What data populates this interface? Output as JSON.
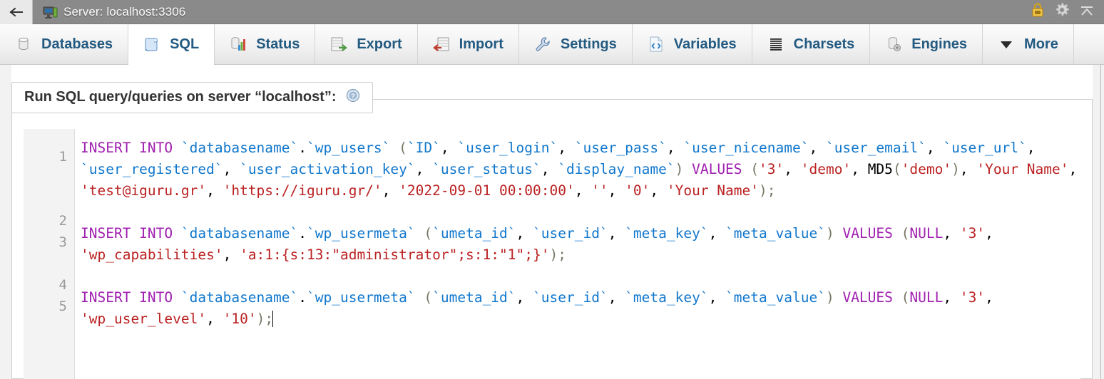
{
  "titlebar": {
    "back_icon": "back-arrow-icon",
    "server_icon": "server-monitor-icon",
    "title": "Server: localhost:3306",
    "right_icons": [
      {
        "name": "lock-icon",
        "label": "Lock"
      },
      {
        "name": "gear-icon",
        "label": "Settings"
      },
      {
        "name": "collapse-icon",
        "label": "Collapse"
      }
    ]
  },
  "tabs": [
    {
      "label": "Databases",
      "icon": "database-icon",
      "active": false
    },
    {
      "label": "SQL",
      "icon": "sql-scroll-icon",
      "active": true
    },
    {
      "label": "Status",
      "icon": "status-chart-icon",
      "active": false
    },
    {
      "label": "Export",
      "icon": "export-icon",
      "active": false
    },
    {
      "label": "Import",
      "icon": "import-icon",
      "active": false
    },
    {
      "label": "Settings",
      "icon": "wrench-icon",
      "active": false
    },
    {
      "label": "Variables",
      "icon": "code-file-icon",
      "active": false
    },
    {
      "label": "Charsets",
      "icon": "charsets-icon",
      "active": false
    },
    {
      "label": "Engines",
      "icon": "engines-icon",
      "active": false
    },
    {
      "label": "More",
      "icon": "chevron-down-icon",
      "active": false
    }
  ],
  "panel": {
    "legend": "Run SQL query/queries on server “localhost”:",
    "help_icon": "help-question-icon"
  },
  "editor": {
    "line_numbers": [
      "1",
      "2",
      "3",
      "4",
      "5"
    ],
    "statements": [
      {
        "line": 1,
        "tokens": [
          {
            "t": "INSERT INTO ",
            "c": "k"
          },
          {
            "t": "`databasename`",
            "c": "id"
          },
          {
            "t": ".",
            "c": "pl"
          },
          {
            "t": "`wp_users`",
            "c": "id"
          },
          {
            "t": " (",
            "c": "p"
          },
          {
            "t": "`ID`",
            "c": "id"
          },
          {
            "t": ", ",
            "c": "pl"
          },
          {
            "t": "`user_login`",
            "c": "id"
          },
          {
            "t": ", ",
            "c": "pl"
          },
          {
            "t": "`user_pass`",
            "c": "id"
          },
          {
            "t": ", ",
            "c": "pl"
          },
          {
            "t": "`user_nicename`",
            "c": "id"
          },
          {
            "t": ", ",
            "c": "pl"
          },
          {
            "t": "`user_email`",
            "c": "id"
          },
          {
            "t": ", ",
            "c": "pl"
          },
          {
            "t": "`user_url`",
            "c": "id"
          },
          {
            "t": ", ",
            "c": "pl"
          },
          {
            "t": "`user_registered`",
            "c": "id"
          },
          {
            "t": ", ",
            "c": "pl"
          },
          {
            "t": "`user_activation_key`",
            "c": "id"
          },
          {
            "t": ", ",
            "c": "pl"
          },
          {
            "t": "`user_status`",
            "c": "id"
          },
          {
            "t": ", ",
            "c": "pl"
          },
          {
            "t": "`display_name`",
            "c": "id"
          },
          {
            "t": ")",
            "c": "p"
          },
          {
            "t": " ",
            "c": "pl"
          },
          {
            "t": "VALUES",
            "c": "k"
          },
          {
            "t": " (",
            "c": "p"
          },
          {
            "t": "'3'",
            "c": "s"
          },
          {
            "t": ", ",
            "c": "pl"
          },
          {
            "t": "'demo'",
            "c": "s"
          },
          {
            "t": ", ",
            "c": "pl"
          },
          {
            "t": "MD5",
            "c": "fn"
          },
          {
            "t": "(",
            "c": "p"
          },
          {
            "t": "'demo'",
            "c": "s"
          },
          {
            "t": ")",
            "c": "p"
          },
          {
            "t": ", ",
            "c": "pl"
          },
          {
            "t": "'Your Name'",
            "c": "s"
          },
          {
            "t": ", ",
            "c": "pl"
          },
          {
            "t": "'test@iguru.gr'",
            "c": "s"
          },
          {
            "t": ", ",
            "c": "pl"
          },
          {
            "t": "'https://iguru.gr/'",
            "c": "s"
          },
          {
            "t": ", ",
            "c": "pl"
          },
          {
            "t": "'2022-09-01 00:00:00'",
            "c": "s"
          },
          {
            "t": ", ",
            "c": "pl"
          },
          {
            "t": "''",
            "c": "s"
          },
          {
            "t": ", ",
            "c": "pl"
          },
          {
            "t": "'0'",
            "c": "s"
          },
          {
            "t": ", ",
            "c": "pl"
          },
          {
            "t": "'Your Name'",
            "c": "s"
          },
          {
            "t": ")",
            "c": "p"
          },
          {
            "t": ";",
            "c": "p"
          }
        ]
      },
      {
        "line": 2,
        "tokens": []
      },
      {
        "line": 3,
        "tokens": [
          {
            "t": "INSERT INTO ",
            "c": "k"
          },
          {
            "t": "`databasename`",
            "c": "id"
          },
          {
            "t": ".",
            "c": "pl"
          },
          {
            "t": "`wp_usermeta`",
            "c": "id"
          },
          {
            "t": " (",
            "c": "p"
          },
          {
            "t": "`umeta_id`",
            "c": "id"
          },
          {
            "t": ", ",
            "c": "pl"
          },
          {
            "t": "`user_id`",
            "c": "id"
          },
          {
            "t": ", ",
            "c": "pl"
          },
          {
            "t": "`meta_key`",
            "c": "id"
          },
          {
            "t": ", ",
            "c": "pl"
          },
          {
            "t": "`meta_value`",
            "c": "id"
          },
          {
            "t": ")",
            "c": "p"
          },
          {
            "t": " ",
            "c": "pl"
          },
          {
            "t": "VALUES",
            "c": "k"
          },
          {
            "t": " (",
            "c": "p"
          },
          {
            "t": "NULL",
            "c": "k"
          },
          {
            "t": ", ",
            "c": "pl"
          },
          {
            "t": "'3'",
            "c": "s"
          },
          {
            "t": ", ",
            "c": "pl"
          },
          {
            "t": "'wp_capabilities'",
            "c": "s"
          },
          {
            "t": ", ",
            "c": "pl"
          },
          {
            "t": "'a:1:{s:13:\"administrator\";s:1:\"1\";}'",
            "c": "s"
          },
          {
            "t": ")",
            "c": "p"
          },
          {
            "t": ";",
            "c": "p"
          }
        ]
      },
      {
        "line": 4,
        "tokens": []
      },
      {
        "line": 5,
        "tokens": [
          {
            "t": "INSERT INTO ",
            "c": "k"
          },
          {
            "t": "`databasename`",
            "c": "id"
          },
          {
            "t": ".",
            "c": "pl"
          },
          {
            "t": "`wp_usermeta`",
            "c": "id"
          },
          {
            "t": " (",
            "c": "p"
          },
          {
            "t": "`umeta_id`",
            "c": "id"
          },
          {
            "t": ", ",
            "c": "pl"
          },
          {
            "t": "`user_id`",
            "c": "id"
          },
          {
            "t": ", ",
            "c": "pl"
          },
          {
            "t": "`meta_key`",
            "c": "id"
          },
          {
            "t": ", ",
            "c": "pl"
          },
          {
            "t": "`meta_value`",
            "c": "id"
          },
          {
            "t": ")",
            "c": "p"
          },
          {
            "t": " ",
            "c": "pl"
          },
          {
            "t": "VALUES",
            "c": "k"
          },
          {
            "t": " (",
            "c": "p"
          },
          {
            "t": "NULL",
            "c": "k"
          },
          {
            "t": ", ",
            "c": "pl"
          },
          {
            "t": "'3'",
            "c": "s"
          },
          {
            "t": ", ",
            "c": "pl"
          },
          {
            "t": "'wp_user_level'",
            "c": "s"
          },
          {
            "t": ", ",
            "c": "pl"
          },
          {
            "t": "'10'",
            "c": "s"
          },
          {
            "t": ")",
            "c": "p"
          },
          {
            "t": ";",
            "c": "p"
          }
        ],
        "caret_after": true
      }
    ]
  },
  "colors": {
    "titlebar_bg": "#8a8a8a",
    "tab_label": "#235a81",
    "keyword": "#a020b0",
    "identifier": "#1177cc",
    "string": "#bb2222",
    "punctuation": "#777766",
    "gutter_bg": "#f3f3f3",
    "gutter_text": "#9a9a9a"
  }
}
